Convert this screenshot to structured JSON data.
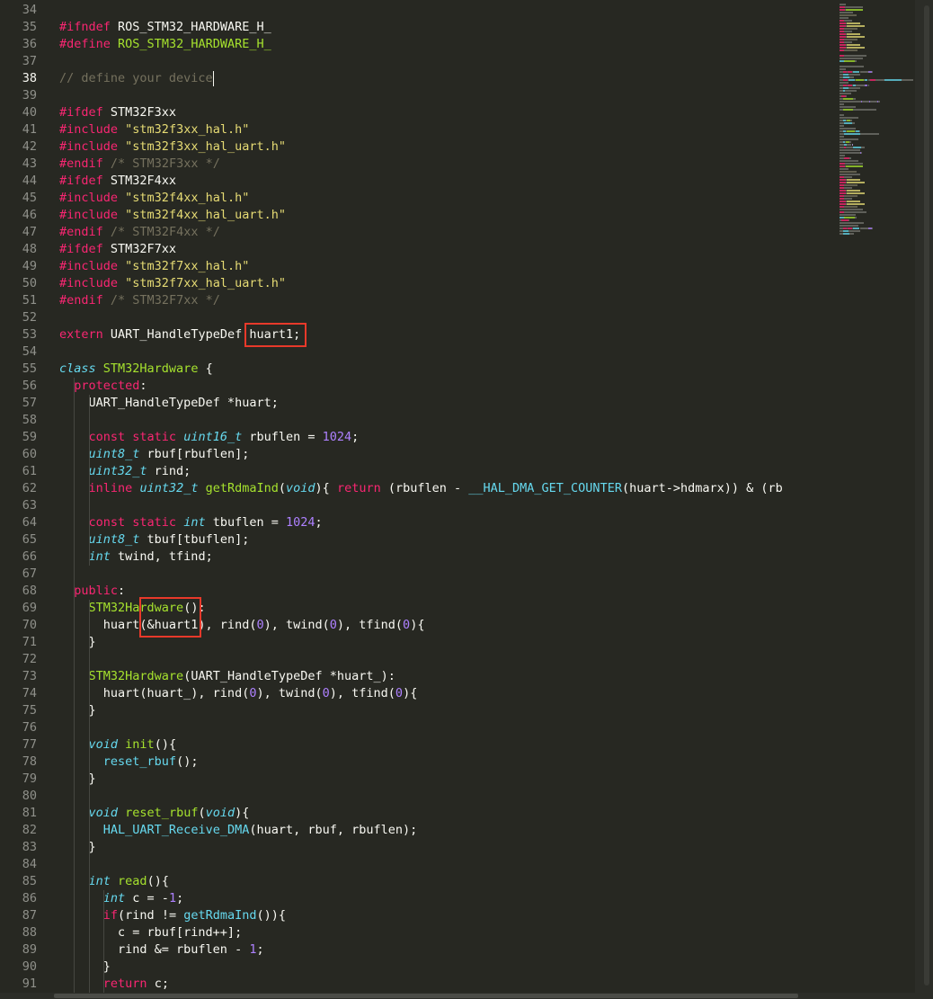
{
  "editor": {
    "active_line": 38,
    "lines": [
      {
        "n": "34",
        "t": []
      },
      {
        "n": "35",
        "t": [
          [
            "k",
            "#ifndef"
          ],
          [
            "p",
            " ROS_STM32_HARDWARE_H_"
          ]
        ]
      },
      {
        "n": "36",
        "t": [
          [
            "k",
            "#define"
          ],
          [
            "p",
            " "
          ],
          [
            "e",
            "ROS_STM32_HARDWARE_H_"
          ]
        ]
      },
      {
        "n": "37",
        "t": []
      },
      {
        "n": "38",
        "t": [
          [
            "c",
            "// define your device"
          ]
        ]
      },
      {
        "n": "39",
        "t": []
      },
      {
        "n": "40",
        "t": [
          [
            "k",
            "#ifdef"
          ],
          [
            "p",
            " STM32F3xx"
          ]
        ]
      },
      {
        "n": "41",
        "t": [
          [
            "k",
            "#include"
          ],
          [
            "p",
            " "
          ],
          [
            "s",
            "\"stm32f3xx_hal.h\""
          ]
        ]
      },
      {
        "n": "42",
        "t": [
          [
            "k",
            "#include"
          ],
          [
            "p",
            " "
          ],
          [
            "s",
            "\"stm32f3xx_hal_uart.h\""
          ]
        ]
      },
      {
        "n": "43",
        "t": [
          [
            "k",
            "#endif"
          ],
          [
            "p",
            " "
          ],
          [
            "c",
            "/* STM32F3xx */"
          ]
        ]
      },
      {
        "n": "44",
        "t": [
          [
            "k",
            "#ifdef"
          ],
          [
            "p",
            " STM32F4xx"
          ]
        ]
      },
      {
        "n": "45",
        "t": [
          [
            "k",
            "#include"
          ],
          [
            "p",
            " "
          ],
          [
            "s",
            "\"stm32f4xx_hal.h\""
          ]
        ]
      },
      {
        "n": "46",
        "t": [
          [
            "k",
            "#include"
          ],
          [
            "p",
            " "
          ],
          [
            "s",
            "\"stm32f4xx_hal_uart.h\""
          ]
        ]
      },
      {
        "n": "47",
        "t": [
          [
            "k",
            "#endif"
          ],
          [
            "p",
            " "
          ],
          [
            "c",
            "/* STM32F4xx */"
          ]
        ]
      },
      {
        "n": "48",
        "t": [
          [
            "k",
            "#ifdef"
          ],
          [
            "p",
            " STM32F7xx"
          ]
        ]
      },
      {
        "n": "49",
        "t": [
          [
            "k",
            "#include"
          ],
          [
            "p",
            " "
          ],
          [
            "s",
            "\"stm32f7xx_hal.h\""
          ]
        ]
      },
      {
        "n": "50",
        "t": [
          [
            "k",
            "#include"
          ],
          [
            "p",
            " "
          ],
          [
            "s",
            "\"stm32f7xx_hal_uart.h\""
          ]
        ]
      },
      {
        "n": "51",
        "t": [
          [
            "k",
            "#endif"
          ],
          [
            "p",
            " "
          ],
          [
            "c",
            "/* STM32F7xx */"
          ]
        ]
      },
      {
        "n": "52",
        "t": []
      },
      {
        "n": "53",
        "t": [
          [
            "k",
            "extern"
          ],
          [
            "p",
            " UART_HandleTypeDef huart1;"
          ]
        ]
      },
      {
        "n": "54",
        "t": []
      },
      {
        "n": "55",
        "t": [
          [
            "sk",
            "class"
          ],
          [
            "p",
            " "
          ],
          [
            "f",
            "STM32Hardware"
          ],
          [
            "p",
            " {"
          ]
        ]
      },
      {
        "n": "56",
        "t": [
          [
            "p",
            "  "
          ],
          [
            "k",
            "protected"
          ],
          [
            "p",
            ":"
          ]
        ]
      },
      {
        "n": "57",
        "t": [
          [
            "p",
            "    UART_HandleTypeDef *huart;"
          ]
        ]
      },
      {
        "n": "58",
        "t": []
      },
      {
        "n": "59",
        "t": [
          [
            "p",
            "    "
          ],
          [
            "k",
            "const"
          ],
          [
            "p",
            " "
          ],
          [
            "k",
            "static"
          ],
          [
            "p",
            " "
          ],
          [
            "t",
            "uint16_t"
          ],
          [
            "p",
            " rbuflen = "
          ],
          [
            "n",
            "1024"
          ],
          [
            "p",
            ";"
          ]
        ]
      },
      {
        "n": "60",
        "t": [
          [
            "p",
            "    "
          ],
          [
            "t",
            "uint8_t"
          ],
          [
            "p",
            " rbuf[rbuflen];"
          ]
        ]
      },
      {
        "n": "61",
        "t": [
          [
            "p",
            "    "
          ],
          [
            "t",
            "uint32_t"
          ],
          [
            "p",
            " rind;"
          ]
        ]
      },
      {
        "n": "62",
        "t": [
          [
            "p",
            "    "
          ],
          [
            "k",
            "inline"
          ],
          [
            "p",
            " "
          ],
          [
            "t",
            "uint32_t"
          ],
          [
            "p",
            " "
          ],
          [
            "f",
            "getRdmaInd"
          ],
          [
            "p",
            "("
          ],
          [
            "t",
            "void"
          ],
          [
            "p",
            "){ "
          ],
          [
            "k",
            "return"
          ],
          [
            "p",
            " (rbuflen - "
          ],
          [
            "m",
            "__HAL_DMA_GET_COUNTER"
          ],
          [
            "p",
            "(huart->hdmarx)) & (rb"
          ]
        ]
      },
      {
        "n": "63",
        "t": []
      },
      {
        "n": "64",
        "t": [
          [
            "p",
            "    "
          ],
          [
            "k",
            "const"
          ],
          [
            "p",
            " "
          ],
          [
            "k",
            "static"
          ],
          [
            "p",
            " "
          ],
          [
            "t",
            "int"
          ],
          [
            "p",
            " tbuflen = "
          ],
          [
            "n",
            "1024"
          ],
          [
            "p",
            ";"
          ]
        ]
      },
      {
        "n": "65",
        "t": [
          [
            "p",
            "    "
          ],
          [
            "t",
            "uint8_t"
          ],
          [
            "p",
            " tbuf[tbuflen];"
          ]
        ]
      },
      {
        "n": "66",
        "t": [
          [
            "p",
            "    "
          ],
          [
            "t",
            "int"
          ],
          [
            "p",
            " twind, tfind;"
          ]
        ]
      },
      {
        "n": "67",
        "t": []
      },
      {
        "n": "68",
        "t": [
          [
            "p",
            "  "
          ],
          [
            "k",
            "public"
          ],
          [
            "p",
            ":"
          ]
        ]
      },
      {
        "n": "69",
        "t": [
          [
            "p",
            "    "
          ],
          [
            "f",
            "STM32Hardware"
          ],
          [
            "p",
            "():"
          ]
        ]
      },
      {
        "n": "70",
        "t": [
          [
            "p",
            "      huart(&huart1), rind("
          ],
          [
            "n",
            "0"
          ],
          [
            "p",
            "), twind("
          ],
          [
            "n",
            "0"
          ],
          [
            "p",
            "), tfind("
          ],
          [
            "n",
            "0"
          ],
          [
            "p",
            "){"
          ]
        ]
      },
      {
        "n": "71",
        "t": [
          [
            "p",
            "    }"
          ]
        ]
      },
      {
        "n": "72",
        "t": []
      },
      {
        "n": "73",
        "t": [
          [
            "p",
            "    "
          ],
          [
            "f",
            "STM32Hardware"
          ],
          [
            "p",
            "(UART_HandleTypeDef *huart_):"
          ]
        ]
      },
      {
        "n": "74",
        "t": [
          [
            "p",
            "      huart(huart_), rind("
          ],
          [
            "n",
            "0"
          ],
          [
            "p",
            "), twind("
          ],
          [
            "n",
            "0"
          ],
          [
            "p",
            "), tfind("
          ],
          [
            "n",
            "0"
          ],
          [
            "p",
            "){"
          ]
        ]
      },
      {
        "n": "75",
        "t": [
          [
            "p",
            "    }"
          ]
        ]
      },
      {
        "n": "76",
        "t": []
      },
      {
        "n": "77",
        "t": [
          [
            "p",
            "    "
          ],
          [
            "t",
            "void"
          ],
          [
            "p",
            " "
          ],
          [
            "f",
            "init"
          ],
          [
            "p",
            "(){"
          ]
        ]
      },
      {
        "n": "78",
        "t": [
          [
            "p",
            "      "
          ],
          [
            "m",
            "reset_rbuf"
          ],
          [
            "p",
            "();"
          ]
        ]
      },
      {
        "n": "79",
        "t": [
          [
            "p",
            "    }"
          ]
        ]
      },
      {
        "n": "80",
        "t": []
      },
      {
        "n": "81",
        "t": [
          [
            "p",
            "    "
          ],
          [
            "t",
            "void"
          ],
          [
            "p",
            " "
          ],
          [
            "f",
            "reset_rbuf"
          ],
          [
            "p",
            "("
          ],
          [
            "t",
            "void"
          ],
          [
            "p",
            "){"
          ]
        ]
      },
      {
        "n": "82",
        "t": [
          [
            "p",
            "      "
          ],
          [
            "m",
            "HAL_UART_Receive_DMA"
          ],
          [
            "p",
            "(huart, rbuf, rbuflen);"
          ]
        ]
      },
      {
        "n": "83",
        "t": [
          [
            "p",
            "    }"
          ]
        ]
      },
      {
        "n": "84",
        "t": []
      },
      {
        "n": "85",
        "t": [
          [
            "p",
            "    "
          ],
          [
            "t",
            "int"
          ],
          [
            "p",
            " "
          ],
          [
            "f",
            "read"
          ],
          [
            "p",
            "(){"
          ]
        ]
      },
      {
        "n": "86",
        "t": [
          [
            "p",
            "      "
          ],
          [
            "t",
            "int"
          ],
          [
            "p",
            " c = -"
          ],
          [
            "n",
            "1"
          ],
          [
            "p",
            ";"
          ]
        ]
      },
      {
        "n": "87",
        "t": [
          [
            "p",
            "      "
          ],
          [
            "k",
            "if"
          ],
          [
            "p",
            "(rind != "
          ],
          [
            "m",
            "getRdmaInd"
          ],
          [
            "p",
            "()){"
          ]
        ]
      },
      {
        "n": "88",
        "t": [
          [
            "p",
            "        c = rbuf[rind++];"
          ]
        ]
      },
      {
        "n": "89",
        "t": [
          [
            "p",
            "        rind &= rbuflen - "
          ],
          [
            "n",
            "1"
          ],
          [
            "p",
            ";"
          ]
        ]
      },
      {
        "n": "90",
        "t": [
          [
            "p",
            "      }"
          ]
        ]
      },
      {
        "n": "91",
        "t": [
          [
            "p",
            "      "
          ],
          [
            "k",
            "return"
          ],
          [
            "p",
            " c;"
          ]
        ]
      }
    ]
  },
  "colors": {
    "background": "#272822",
    "keyword": "#f92672",
    "string": "#e6db74",
    "comment": "#75715e",
    "type": "#66d9ef",
    "function": "#a6e22e",
    "number": "#ae81ff",
    "annotation_box": "#e8392a"
  }
}
